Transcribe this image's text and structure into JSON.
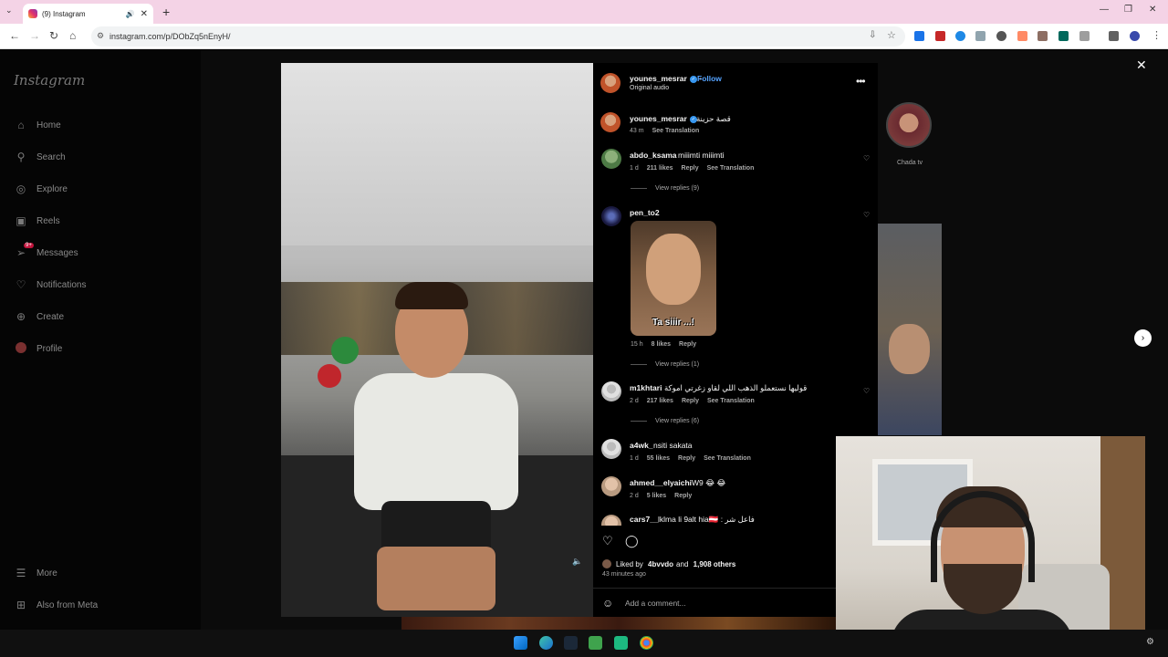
{
  "browser": {
    "tab_title": "(9) Instagram",
    "url": "instagram.com/p/DObZq5nEnyH/"
  },
  "sidebar": {
    "logo": "Instagram",
    "messages_badge": "9+",
    "items": [
      {
        "label": "Home",
        "icon": "home-icon"
      },
      {
        "label": "Search",
        "icon": "search-icon"
      },
      {
        "label": "Explore",
        "icon": "compass-icon"
      },
      {
        "label": "Reels",
        "icon": "reels-icon"
      },
      {
        "label": "Messages",
        "icon": "messenger-icon"
      },
      {
        "label": "Notifications",
        "icon": "heart-icon"
      },
      {
        "label": "Create",
        "icon": "plus-square-icon"
      },
      {
        "label": "Profile",
        "icon": "avatar"
      }
    ],
    "more": "More",
    "also_from_meta": "Also from Meta"
  },
  "post": {
    "author": "younes_mesrar",
    "follow_label": "Follow",
    "audio": "Original audio",
    "caption_author": "younes_mesrar",
    "caption": "قصة حزينة",
    "caption_time": "43 m",
    "caption_translate": "See Translation",
    "likes_prefix": "Liked by",
    "liked_by_user": "4bvvdo",
    "likes_joiner": "and",
    "likes_others": "1,908 others",
    "time_ago": "43 minutes ago",
    "add_comment_placeholder": "Add a comment..."
  },
  "comments": [
    {
      "user": "abdo_ksama",
      "text": "miiimti miiimti",
      "time": "1 d",
      "likes": "211 likes",
      "reply": "Reply",
      "translate": "See Translation",
      "view_replies": "View replies (9)"
    },
    {
      "user": "pen_to2",
      "text": "",
      "sticker_text": "Ta siiir ...!",
      "time": "15 h",
      "likes": "8 likes",
      "reply": "Reply",
      "view_replies": "View replies (1)"
    },
    {
      "user": "m1khtari",
      "text": "قوليها نستعملو الذهب اللي لقاو زغرتي اموكة",
      "time": "2 d",
      "likes": "217 likes",
      "reply": "Reply",
      "translate": "See Translation",
      "view_replies": "View replies (6)"
    },
    {
      "user": "a4wk_",
      "text": "nsiti sakata",
      "time": "1 d",
      "likes": "55 likes",
      "reply": "Reply",
      "translate": "See Translation"
    },
    {
      "user": "ahmed__elyaichi",
      "text": "W9 😂 😂",
      "time": "2 d",
      "likes": "5 likes",
      "reply": "Reply"
    },
    {
      "user": "cars7__",
      "text": "lklma li 9alt hia🇦🇹 : فاعل شر"
    }
  ],
  "side": {
    "story_name": "Chada tv"
  }
}
